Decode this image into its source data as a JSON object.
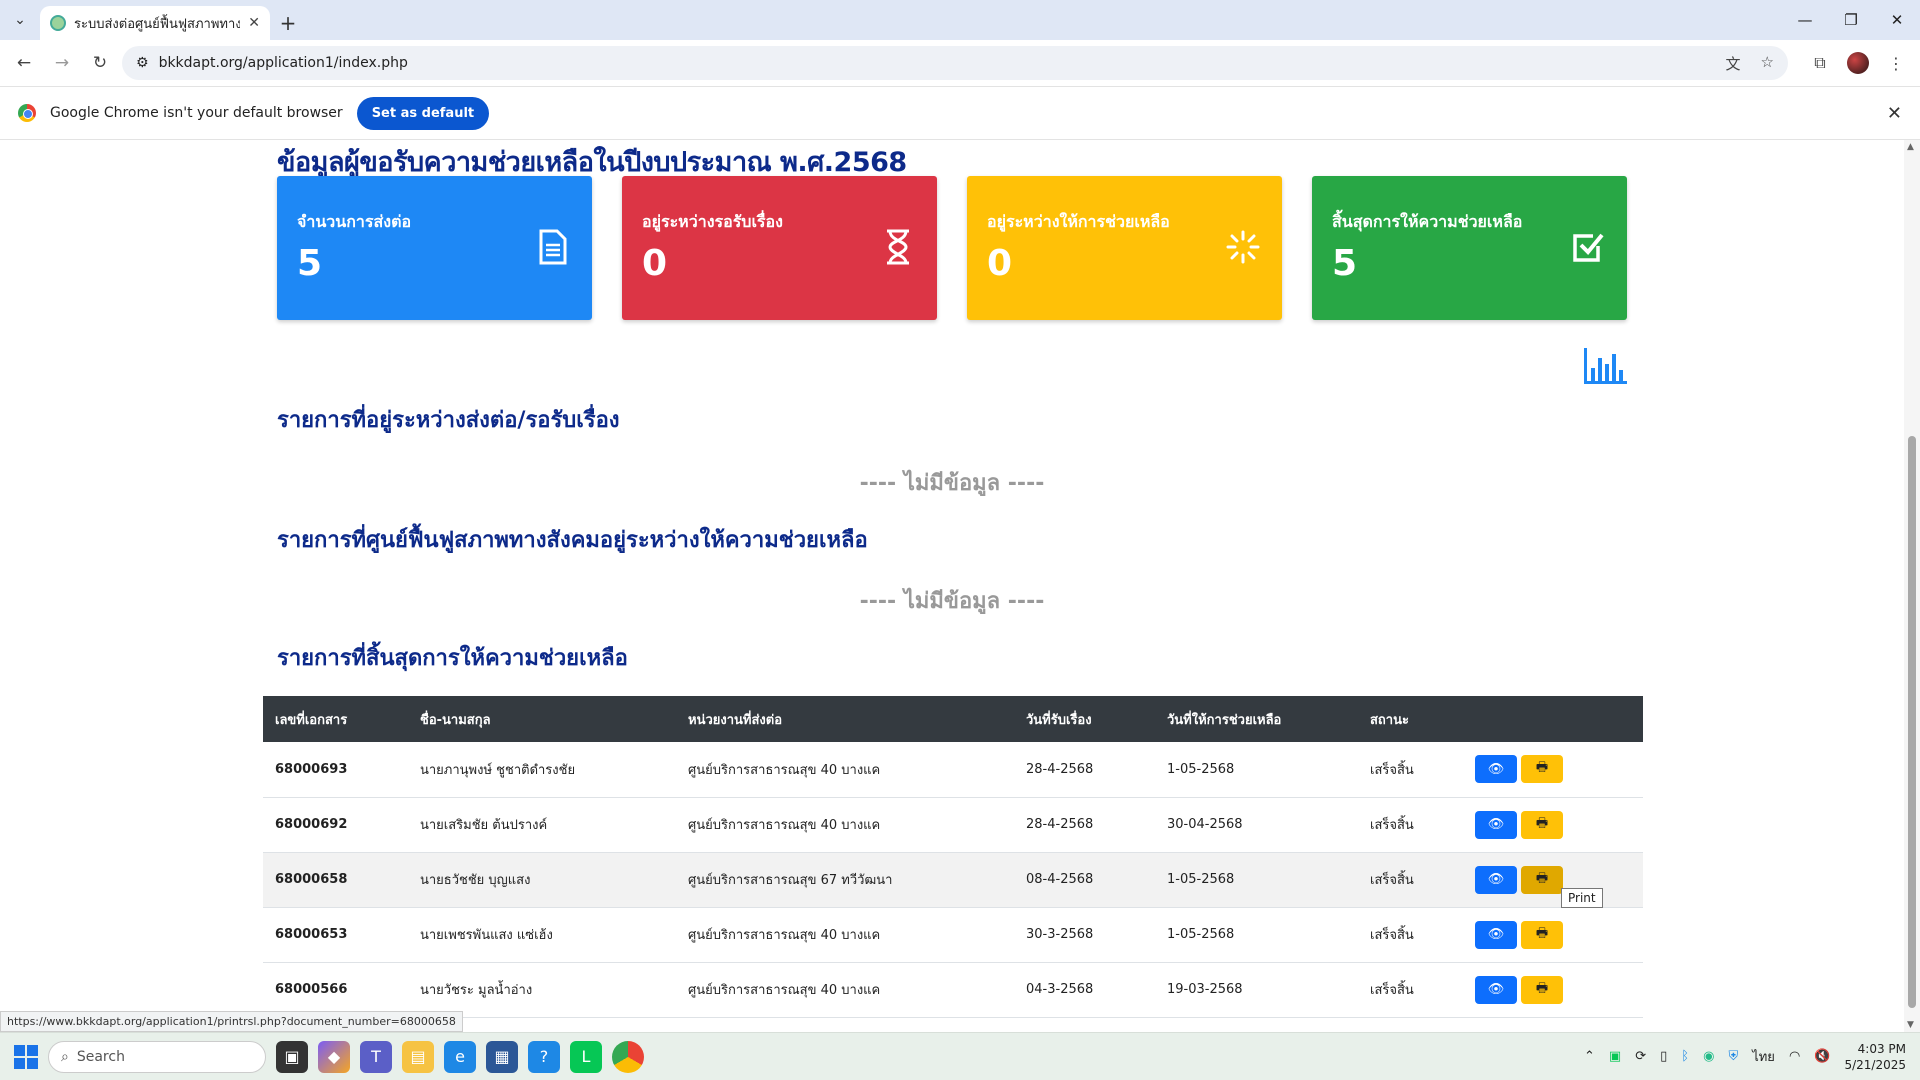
{
  "browser": {
    "tab_title": "ระบบส่งต่อศูนย์ฟื้นฟูสภาพทางสังคม",
    "url": "bkkdapt.org/application1/index.php",
    "infobar_message": "Google Chrome isn't your default browser",
    "infobar_button": "Set as default",
    "status_url": "https://www.bkkdapt.org/application1/printrsl.php?document_number=68000658"
  },
  "page": {
    "heading": "ข้อมูลผู้ขอรับความช่วยเหลือในปีงบประมาณ พ.ศ.2568",
    "cards": [
      {
        "label": "จำนวนการส่งต่อ",
        "value": "5",
        "color": "#1e88f5",
        "icon": "document-icon"
      },
      {
        "label": "อยู่ระหว่างรอรับเรื่อง",
        "value": "0",
        "color": "#dc3545",
        "icon": "hourglass-icon"
      },
      {
        "label": "อยู่ระหว่างให้การช่วยเหลือ",
        "value": "0",
        "color": "#ffc107",
        "icon": "spinner-icon"
      },
      {
        "label": "สิ้นสุดการให้ความช่วยเหลือ",
        "value": "5",
        "color": "#28a745",
        "icon": "check-square-icon"
      }
    ],
    "section_pending": "รายการที่อยู่ระหว่างส่งต่อ/รอรับเรื่อง",
    "section_in_progress": "รายการที่ศูนย์ฟื้นฟูสภาพทางสังคมอยู่ระหว่างให้ความช่วยเหลือ",
    "section_completed": "รายการที่สิ้นสุดการให้ความช่วยเหลือ",
    "no_data": "---- ไม่มีข้อมูล ----",
    "table": {
      "headers": [
        "เลขที่เอกสาร",
        "ชื่อ-นามสกุล",
        "หน่วยงานที่ส่งต่อ",
        "วันที่รับเรื่อง",
        "วันที่ให้การช่วยเหลือ",
        "สถานะ",
        ""
      ],
      "rows": [
        {
          "doc": "68000693",
          "name": "นายภานุพงษ์ ชูชาติดำรงชัย",
          "agency": "ศูนย์บริการสาธารณสุข 40 บางแค",
          "received": "28-4-2568",
          "helped": "1-05-2568",
          "status": "เสร็จสิ้น"
        },
        {
          "doc": "68000692",
          "name": "นายเสริมชัย ต้นปรางค์",
          "agency": "ศูนย์บริการสาธารณสุข 40 บางแค",
          "received": "28-4-2568",
          "helped": "30-04-2568",
          "status": "เสร็จสิ้น"
        },
        {
          "doc": "68000658",
          "name": "นายธวัชชัย บุญแสง",
          "agency": "ศูนย์บริการสาธารณสุข 67 ทวีวัฒนา",
          "received": "08-4-2568",
          "helped": "1-05-2568",
          "status": "เสร็จสิ้น"
        },
        {
          "doc": "68000653",
          "name": "นายเพชรพันแสง แซ่เฮ้ง",
          "agency": "ศูนย์บริการสาธารณสุข 40 บางแค",
          "received": "30-3-2568",
          "helped": "1-05-2568",
          "status": "เสร็จสิ้น"
        },
        {
          "doc": "68000566",
          "name": "นายวัชระ มูลน้ำอ่าง",
          "agency": "ศูนย์บริการสาธารณสุข 40 บางแค",
          "received": "04-3-2568",
          "helped": "19-03-2568",
          "status": "เสร็จสิ้น"
        }
      ]
    },
    "tooltip": "Print"
  },
  "taskbar": {
    "search_placeholder": "Search",
    "lang": "ไทย",
    "time": "4:03 PM",
    "date": "5/21/2025"
  }
}
